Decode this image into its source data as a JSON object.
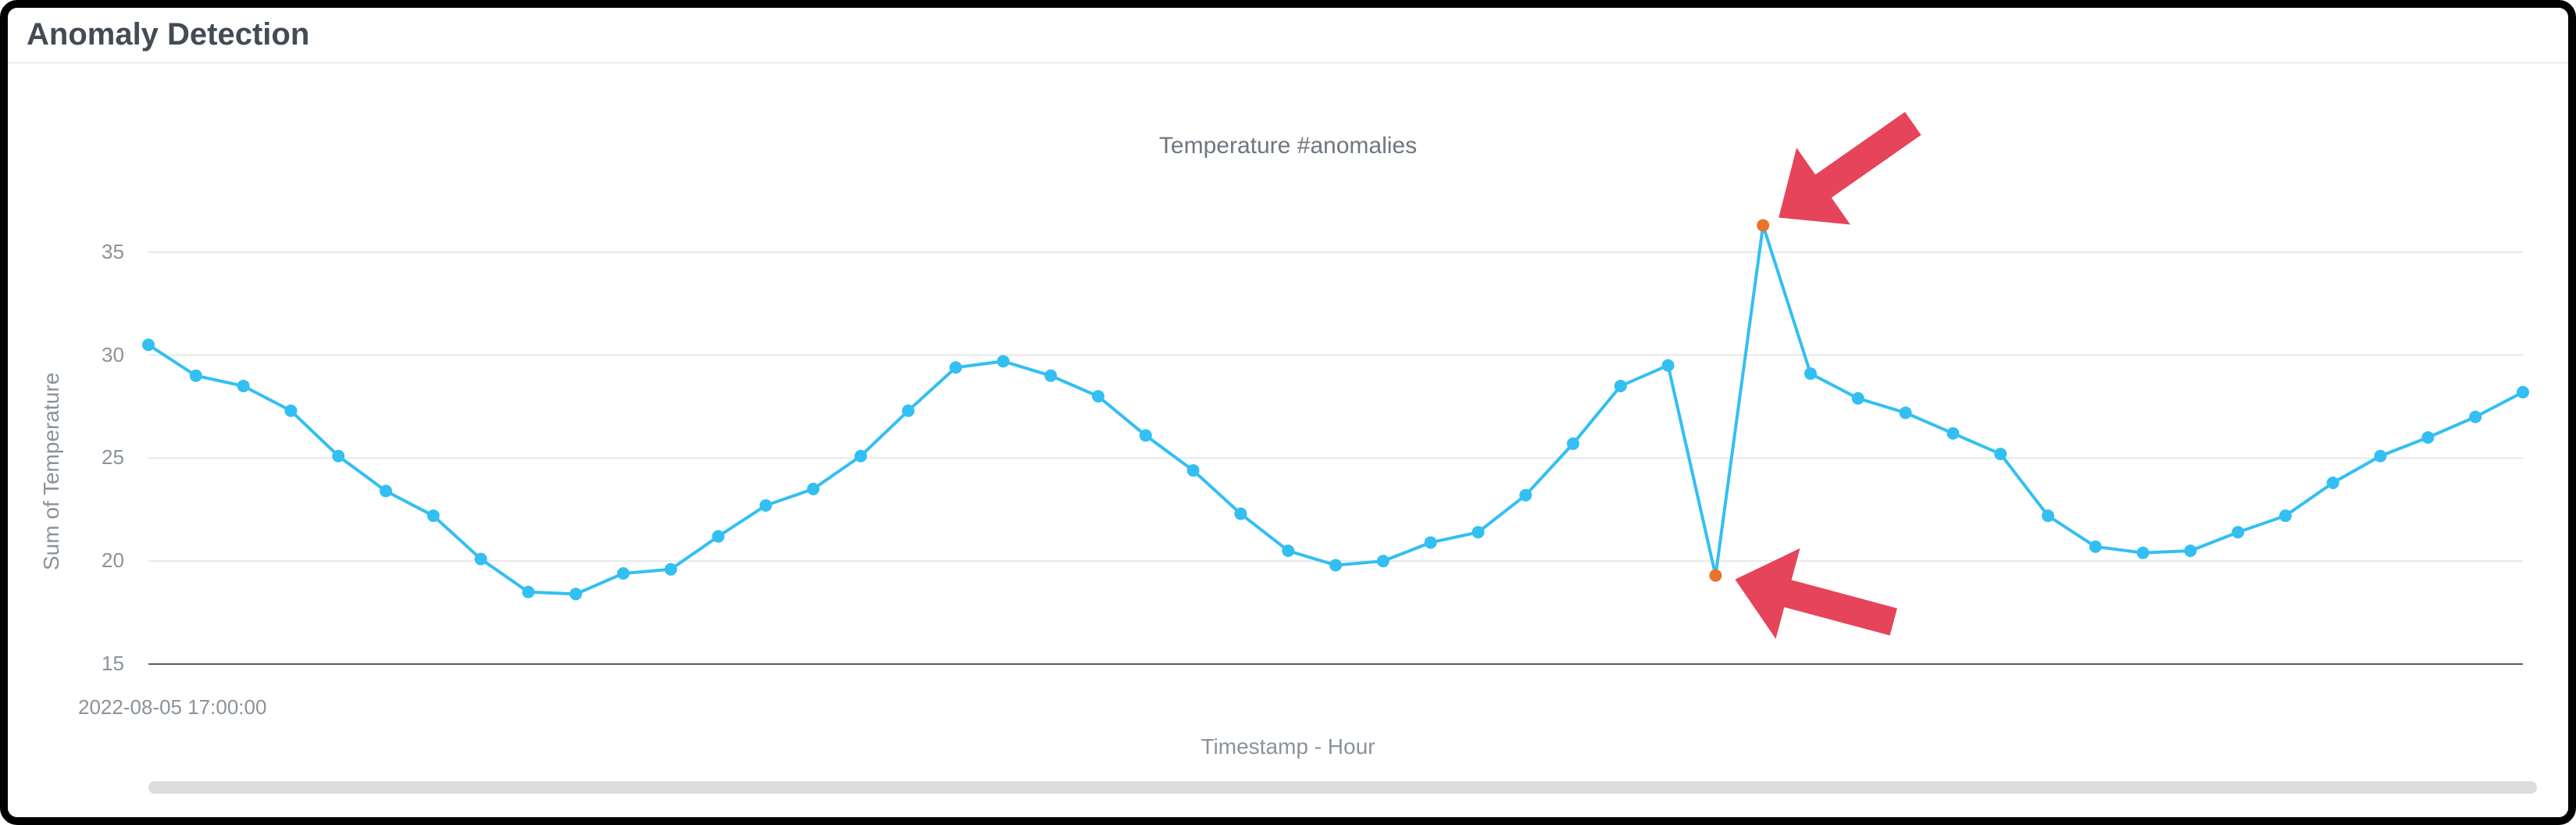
{
  "panel": {
    "title": "Anomaly Detection"
  },
  "chart_data": {
    "type": "line",
    "title": "Temperature #anomalies",
    "xlabel": "Timestamp - Hour",
    "ylabel": "Sum of Temperature",
    "x_tick_label": "2022-08-05 17:00:00",
    "ylim": [
      15,
      37
    ],
    "y_ticks": [
      15,
      20,
      25,
      30,
      35
    ],
    "x": [
      0,
      1,
      2,
      3,
      4,
      5,
      6,
      7,
      8,
      9,
      10,
      11,
      12,
      13,
      14,
      15,
      16,
      17,
      18,
      19,
      20,
      21,
      22,
      23,
      24,
      25,
      26,
      27,
      28,
      29,
      30,
      31,
      32,
      33,
      34,
      35,
      36,
      37,
      38,
      39,
      40,
      41,
      42,
      43,
      44,
      45,
      46
    ],
    "values": [
      30.5,
      29.0,
      28.5,
      27.3,
      25.1,
      23.4,
      22.2,
      20.1,
      18.5,
      18.4,
      19.4,
      19.6,
      21.2,
      22.7,
      23.5,
      25.1,
      27.3,
      29.4,
      29.7,
      29.0,
      28.0,
      26.1,
      24.4,
      22.3,
      20.5,
      19.8,
      20.0,
      20.9,
      21.4,
      23.2,
      25.7,
      28.5,
      29.5,
      19.3,
      36.3,
      29.1,
      27.9,
      27.2,
      26.2,
      25.2,
      22.2,
      20.7,
      20.4,
      20.5,
      21.4,
      22.2,
      23.8,
      25.1,
      26.0,
      27.0,
      28.2
    ],
    "anomaly_indices": [
      33,
      34
    ],
    "annotations": [
      {
        "type": "arrow",
        "target_index": 34,
        "dir": "down-left",
        "label": ""
      },
      {
        "type": "arrow",
        "target_index": 33,
        "dir": "left",
        "label": ""
      }
    ]
  }
}
